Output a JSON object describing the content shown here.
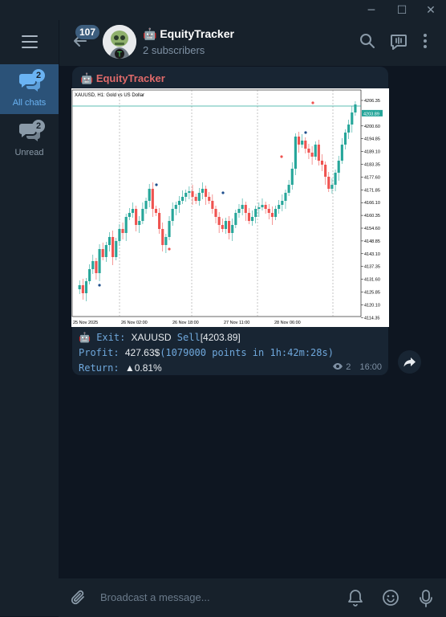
{
  "window": {
    "minimize": "─",
    "maximize": "☐",
    "close": "✕"
  },
  "sidebar": {
    "folders": [
      {
        "label": "All chats",
        "badge": "2",
        "active": true
      },
      {
        "label": "Unread",
        "badge": "2",
        "active": false
      }
    ]
  },
  "header": {
    "unread_count": "107",
    "title": "EquityTracker",
    "subtitle": "2 subscribers",
    "icons": [
      "search-icon",
      "voice-chat-icon",
      "more-vertical-icon"
    ]
  },
  "message": {
    "sender": "EquityTracker",
    "chart_image": {
      "title": "XAUUSD, H1:  Gold vs US Dollar",
      "price_labels": [
        "4206.35",
        "4203.89",
        "4200.60",
        "4194.85",
        "4189.10",
        "4183.35",
        "4177.60",
        "4171.85",
        "4166.10",
        "4160.35",
        "4154.60",
        "4148.85",
        "4143.10",
        "4137.35",
        "4131.60",
        "4125.85",
        "4120.10",
        "4114.35"
      ],
      "current_price": "4203.89",
      "date_labels": [
        "25 Nov 2025",
        "26 Nov 02:00",
        "26 Nov 18:00",
        "27 Nov 11:00",
        "28 Nov 06:00"
      ]
    },
    "exit_label": "Exit:",
    "exit_symbol": "XAUUSD",
    "exit_side": "Sell",
    "exit_price": "[4203.89]",
    "profit_label": "Profit:",
    "profit_value": "427.63$",
    "profit_detail": "(1079000 points in 1h:42m:28s)",
    "return_label": "Return:",
    "return_value": "▲0.81%",
    "views": "2",
    "time": "16:00"
  },
  "composer": {
    "placeholder": "Broadcast a message..."
  },
  "colors": {
    "bg": "#0e1621",
    "panel": "#17212b",
    "accent": "#6ab3f3",
    "sender": "#e06a6a",
    "bull": "#26a69a",
    "bear": "#ef5350"
  }
}
